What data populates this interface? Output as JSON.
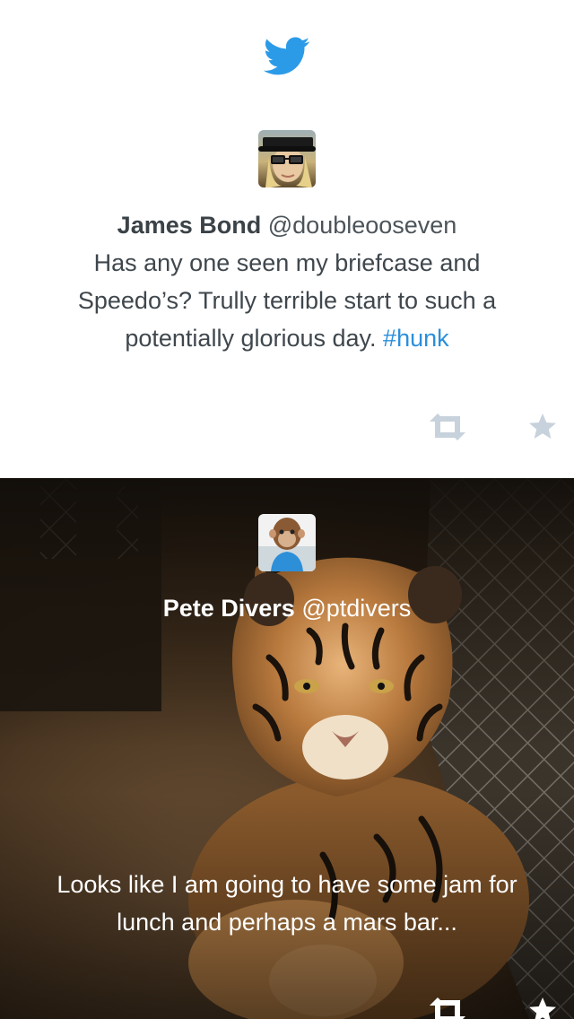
{
  "tweets": [
    {
      "name": "James Bond",
      "handle": "@doubleooseven",
      "text": "Has any one seen my briefcase and Speedo’s? Trully terrible start to such a potentially glorious day.",
      "hashtag": "#hunk"
    },
    {
      "name": "Pete Divers",
      "handle": "@ptdivers",
      "text": "Looks like I am going to have some jam for lunch and perhaps a mars bar..."
    }
  ],
  "colors": {
    "twitter_blue": "#2b9be8",
    "hashtag_blue": "#2b8fdb",
    "icon_grey": "#c7d2dc",
    "text_dark": "#3f474d"
  },
  "icons": [
    "twitter-bird-icon",
    "retweet-icon",
    "star-icon"
  ]
}
